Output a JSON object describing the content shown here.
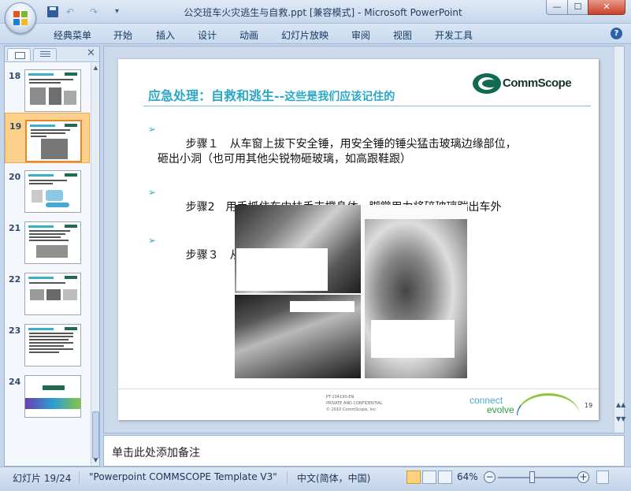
{
  "window": {
    "title": "公交班车火灾逃生与自救.ppt [兼容模式] - Microsoft PowerPoint",
    "min": "—",
    "max": "☐",
    "close": "✕"
  },
  "quick_access": {
    "undo": "↶",
    "redo": "↷",
    "customize": "▾"
  },
  "ribbon_tabs": [
    "经典菜单",
    "开始",
    "插入",
    "设计",
    "动画",
    "幻灯片放映",
    "审阅",
    "视图",
    "开发工具"
  ],
  "help": "?",
  "left_pane": {
    "close": "✕",
    "thumbnails": [
      {
        "number": "18",
        "selected": false
      },
      {
        "number": "19",
        "selected": true
      },
      {
        "number": "20",
        "selected": false
      },
      {
        "number": "21",
        "selected": false
      },
      {
        "number": "22",
        "selected": false
      },
      {
        "number": "23",
        "selected": false
      },
      {
        "number": "24",
        "selected": false
      }
    ]
  },
  "slide": {
    "title_main": "应急处理：自救和逃生--",
    "title_tail": "这些是我们应该记住的",
    "logo_text": "CommScope",
    "bullet_marker": "➢",
    "bullets": [
      "步骤１　从车窗上拔下安全锤，用安全锤的锤尖猛击玻璃边缘部位，\n砸出小洞（也可用其他尖锐物砸玻璃，如高跟鞋跟）",
      "步骤2　用手抓住车内扶手支撑身体，脚掌用力将碎玻璃踹出车外",
      "步骤３　从窗口逃生"
    ],
    "footer_lines": [
      "PT-104190-EN",
      "PRIVATE AND CONFIDENTIAL",
      "© 2010 CommScope, Inc"
    ],
    "connect_text": "connect",
    "evolve_text": "evolve",
    "page_number": "19"
  },
  "notes_placeholder": "单击此处添加备注",
  "status": {
    "slide_counter": "幻灯片 19/24",
    "template": "\"Powerpoint COMMSCOPE Template V3\"",
    "language": "中文(简体，中国)",
    "zoom": "64%",
    "zoom_out": "−",
    "zoom_in": "+"
  },
  "colors": {
    "title_accent": "#2aa8c4",
    "commscope_green": "#0f6a4f",
    "selection": "#fcd08a"
  }
}
